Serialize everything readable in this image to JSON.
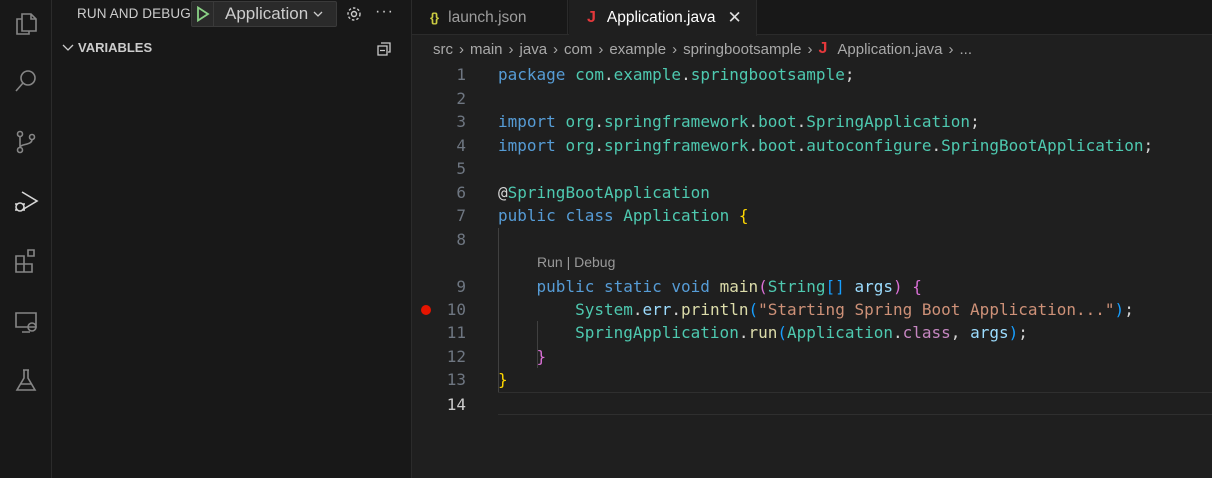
{
  "sidebar": {
    "title": "RUN AND DEBUG",
    "config": "Application",
    "more": "···",
    "section": "VARIABLES"
  },
  "tabs": [
    {
      "label": "launch.json",
      "icon": "{}"
    },
    {
      "label": "Application.java",
      "icon": "J",
      "close": "✕"
    }
  ],
  "breadcrumb": [
    "src",
    "main",
    "java",
    "com",
    "example",
    "springbootsample",
    "Application.java",
    "..."
  ],
  "breadcrumb_file_icon": "J",
  "codelens": {
    "run": "Run",
    "sep": " | ",
    "debug": "Debug"
  },
  "breakpoint_line": 10,
  "current_line": 14,
  "lines": [
    {
      "n": "1",
      "t": [
        [
          "package",
          "kw"
        ],
        [
          " ",
          "pu"
        ],
        [
          "com",
          "ty"
        ],
        [
          ".",
          "pu"
        ],
        [
          "example",
          "ty"
        ],
        [
          ".",
          "pu"
        ],
        [
          "springbootsample",
          "ty"
        ],
        [
          ";",
          "pu"
        ]
      ]
    },
    {
      "n": "2",
      "t": []
    },
    {
      "n": "3",
      "t": [
        [
          "import",
          "kw"
        ],
        [
          " ",
          "pu"
        ],
        [
          "org",
          "ty"
        ],
        [
          ".",
          "pu"
        ],
        [
          "springframework",
          "ty"
        ],
        [
          ".",
          "pu"
        ],
        [
          "boot",
          "ty"
        ],
        [
          ".",
          "pu"
        ],
        [
          "SpringApplication",
          "ty"
        ],
        [
          ";",
          "pu"
        ]
      ]
    },
    {
      "n": "4",
      "t": [
        [
          "import",
          "kw"
        ],
        [
          " ",
          "pu"
        ],
        [
          "org",
          "ty"
        ],
        [
          ".",
          "pu"
        ],
        [
          "springframework",
          "ty"
        ],
        [
          ".",
          "pu"
        ],
        [
          "boot",
          "ty"
        ],
        [
          ".",
          "pu"
        ],
        [
          "autoconfigure",
          "ty"
        ],
        [
          ".",
          "pu"
        ],
        [
          "SpringBootApplication",
          "ty"
        ],
        [
          ";",
          "pu"
        ]
      ]
    },
    {
      "n": "5",
      "t": []
    },
    {
      "n": "6",
      "t": [
        [
          "@",
          "pu"
        ],
        [
          "SpringBootApplication",
          "ty"
        ]
      ]
    },
    {
      "n": "7",
      "t": [
        [
          "public",
          "kw"
        ],
        [
          " ",
          "pu"
        ],
        [
          "class",
          "kw"
        ],
        [
          " ",
          "pu"
        ],
        [
          "Application",
          "ty"
        ],
        [
          " ",
          "pu"
        ],
        [
          "{",
          "b1"
        ]
      ]
    },
    {
      "n": "8",
      "t": []
    },
    {
      "n": "9",
      "t": [
        [
          "    public",
          "kw"
        ],
        [
          " ",
          "pu"
        ],
        [
          "static",
          "kw"
        ],
        [
          " ",
          "pu"
        ],
        [
          "void",
          "kw"
        ],
        [
          " ",
          "pu"
        ],
        [
          "main",
          "fn"
        ],
        [
          "(",
          "b2"
        ],
        [
          "String",
          "ty"
        ],
        [
          "[]",
          "b3"
        ],
        [
          " ",
          "pu"
        ],
        [
          "args",
          "va"
        ],
        [
          ")",
          "b2"
        ],
        [
          " ",
          "pu"
        ],
        [
          "{",
          "b2"
        ]
      ]
    },
    {
      "n": "10",
      "t": [
        [
          "        System",
          "ty"
        ],
        [
          ".",
          "pu"
        ],
        [
          "err",
          "va"
        ],
        [
          ".",
          "pu"
        ],
        [
          "println",
          "fn"
        ],
        [
          "(",
          "b3"
        ],
        [
          "\"Starting Spring Boot Application...\"",
          "st"
        ],
        [
          ")",
          "b3"
        ],
        [
          ";",
          "pu"
        ]
      ]
    },
    {
      "n": "11",
      "t": [
        [
          "        SpringApplication",
          "ty"
        ],
        [
          ".",
          "pu"
        ],
        [
          "run",
          "fn"
        ],
        [
          "(",
          "b3"
        ],
        [
          "Application",
          "ty"
        ],
        [
          ".",
          "pu"
        ],
        [
          "class",
          "pk"
        ],
        [
          ", ",
          "pu"
        ],
        [
          "args",
          "va"
        ],
        [
          ")",
          "b3"
        ],
        [
          ";",
          "pu"
        ]
      ]
    },
    {
      "n": "12",
      "t": [
        [
          "    }",
          "b2"
        ]
      ]
    },
    {
      "n": "13",
      "t": [
        [
          "}",
          "b1"
        ]
      ]
    },
    {
      "n": "14",
      "t": []
    }
  ],
  "colors": {
    "accent": "#0078d4",
    "breakpoint": "#e51400",
    "run": "#89d185"
  }
}
